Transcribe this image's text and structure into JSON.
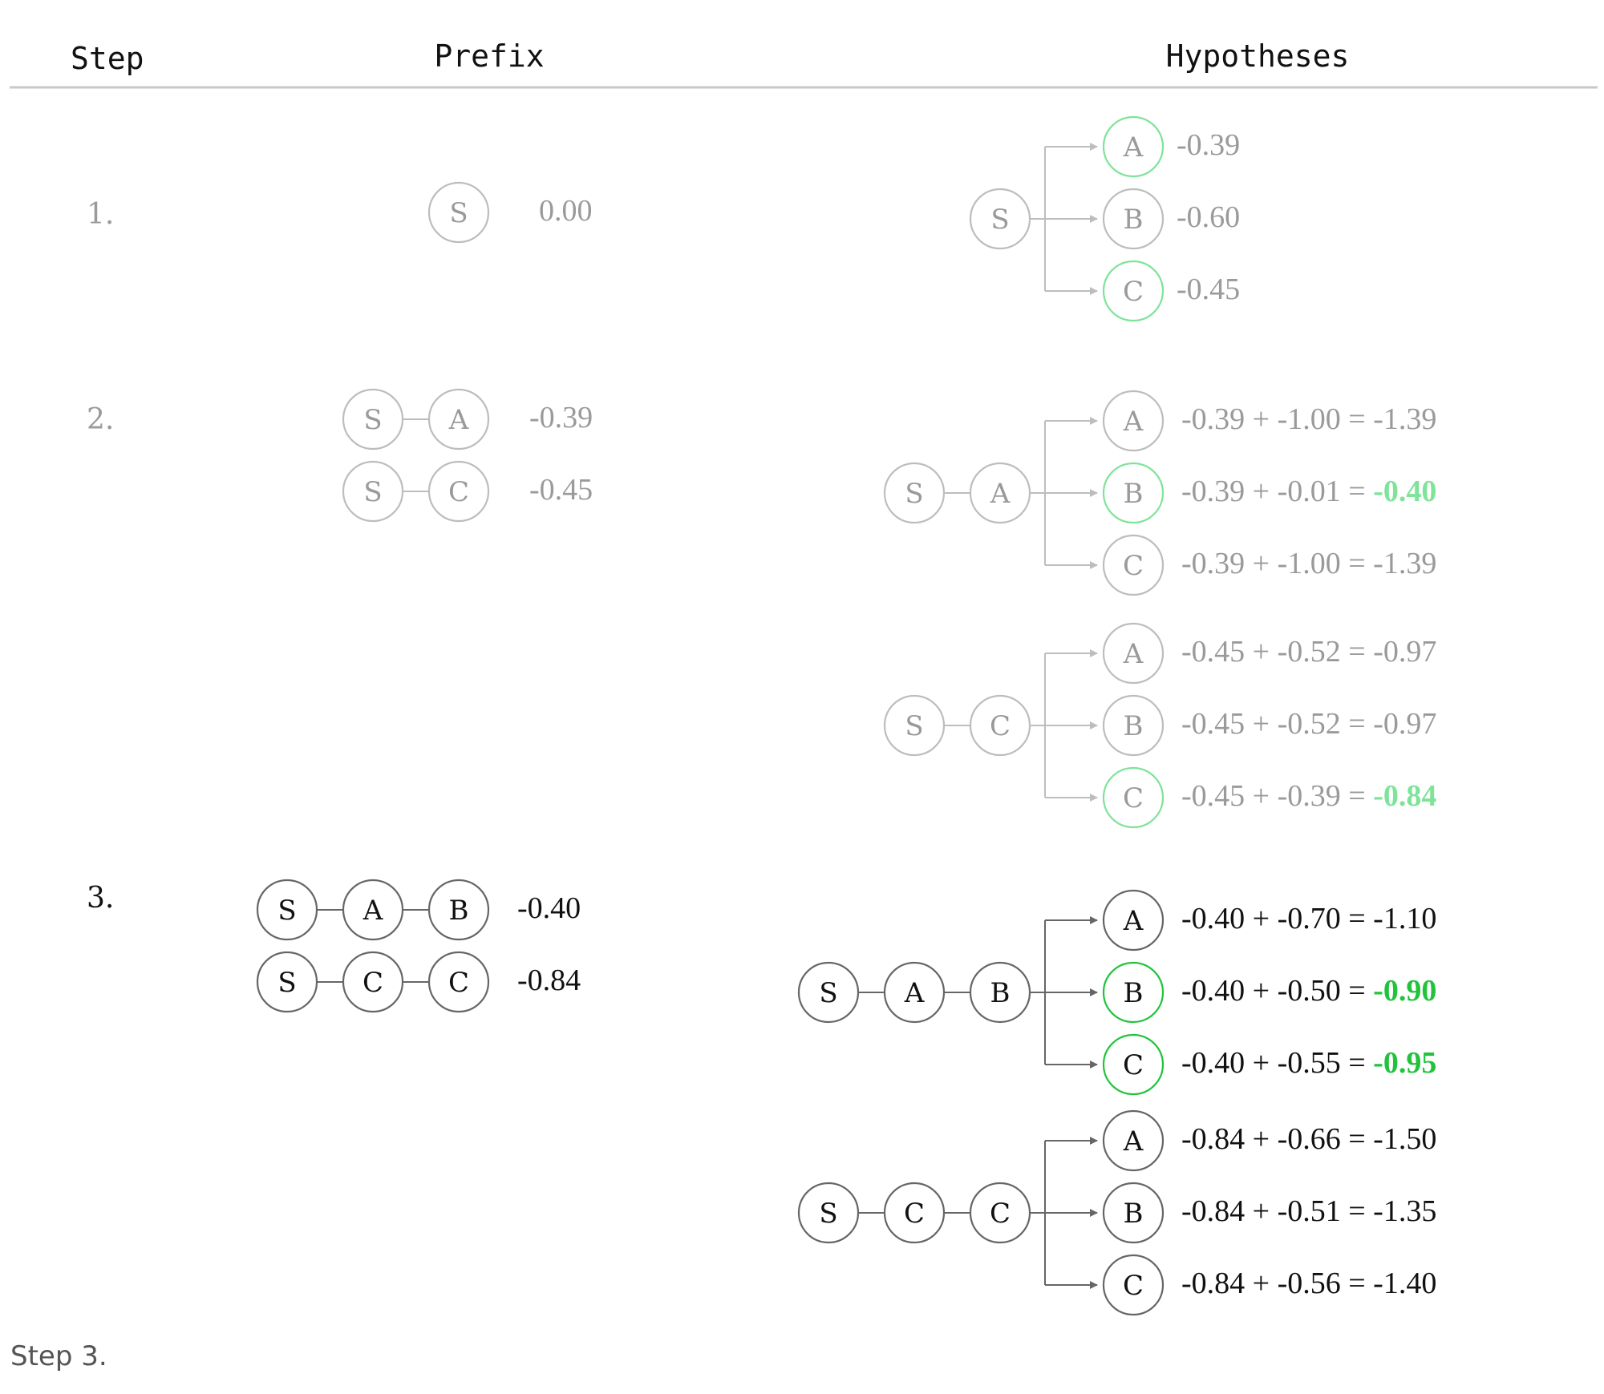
{
  "header": {
    "step": "Step",
    "prefix": "Prefix",
    "hypotheses": "Hypotheses"
  },
  "colors": {
    "faded": "#9a9a9a",
    "faded_line": "#bdbdbd",
    "dark": "#111111",
    "dark_line": "#666666",
    "green_light": "#7fe39a",
    "green": "#22c33c",
    "rule": "#c8c8c8"
  },
  "steps": [
    {
      "label": "1.",
      "faded": true,
      "prefixes": [
        {
          "tokens": [
            "S"
          ],
          "score": "0.00"
        }
      ],
      "groups": [
        {
          "prefix": [
            "S"
          ],
          "hyps": [
            {
              "token": "A",
              "parts": [],
              "total": "-0.39",
              "selected": true
            },
            {
              "token": "B",
              "parts": [],
              "total": "-0.60",
              "selected": false
            },
            {
              "token": "C",
              "parts": [],
              "total": "-0.45",
              "selected": true
            }
          ]
        }
      ]
    },
    {
      "label": "2.",
      "faded": true,
      "prefixes": [
        {
          "tokens": [
            "S",
            "A"
          ],
          "score": "-0.39"
        },
        {
          "tokens": [
            "S",
            "C"
          ],
          "score": "-0.45"
        }
      ],
      "groups": [
        {
          "prefix": [
            "S",
            "A"
          ],
          "hyps": [
            {
              "token": "A",
              "parts": [
                "-0.39",
                "-1.00"
              ],
              "total": "-1.39",
              "selected": false
            },
            {
              "token": "B",
              "parts": [
                "-0.39",
                "-0.01"
              ],
              "total": "-0.40",
              "selected": true
            },
            {
              "token": "C",
              "parts": [
                "-0.39",
                "-1.00"
              ],
              "total": "-1.39",
              "selected": false
            }
          ]
        },
        {
          "prefix": [
            "S",
            "C"
          ],
          "hyps": [
            {
              "token": "A",
              "parts": [
                "-0.45",
                "-0.52"
              ],
              "total": "-0.97",
              "selected": false
            },
            {
              "token": "B",
              "parts": [
                "-0.45",
                "-0.52"
              ],
              "total": "-0.97",
              "selected": false
            },
            {
              "token": "C",
              "parts": [
                "-0.45",
                "-0.39"
              ],
              "total": "-0.84",
              "selected": true
            }
          ]
        }
      ]
    },
    {
      "label": "3.",
      "faded": false,
      "prefixes": [
        {
          "tokens": [
            "S",
            "A",
            "B"
          ],
          "score": "-0.40"
        },
        {
          "tokens": [
            "S",
            "C",
            "C"
          ],
          "score": "-0.84"
        }
      ],
      "groups": [
        {
          "prefix": [
            "S",
            "A",
            "B"
          ],
          "hyps": [
            {
              "token": "A",
              "parts": [
                "-0.40",
                "-0.70"
              ],
              "total": "-1.10",
              "selected": false
            },
            {
              "token": "B",
              "parts": [
                "-0.40",
                "-0.50"
              ],
              "total": "-0.90",
              "selected": true
            },
            {
              "token": "C",
              "parts": [
                "-0.40",
                "-0.55"
              ],
              "total": "-0.95",
              "selected": true
            }
          ]
        },
        {
          "prefix": [
            "S",
            "C",
            "C"
          ],
          "hyps": [
            {
              "token": "A",
              "parts": [
                "-0.84",
                "-0.66"
              ],
              "total": "-1.50",
              "selected": false
            },
            {
              "token": "B",
              "parts": [
                "-0.84",
                "-0.51"
              ],
              "total": "-1.35",
              "selected": false
            },
            {
              "token": "C",
              "parts": [
                "-0.84",
                "-0.56"
              ],
              "total": "-1.40",
              "selected": false
            }
          ]
        }
      ]
    }
  ],
  "caption": "Step 3."
}
